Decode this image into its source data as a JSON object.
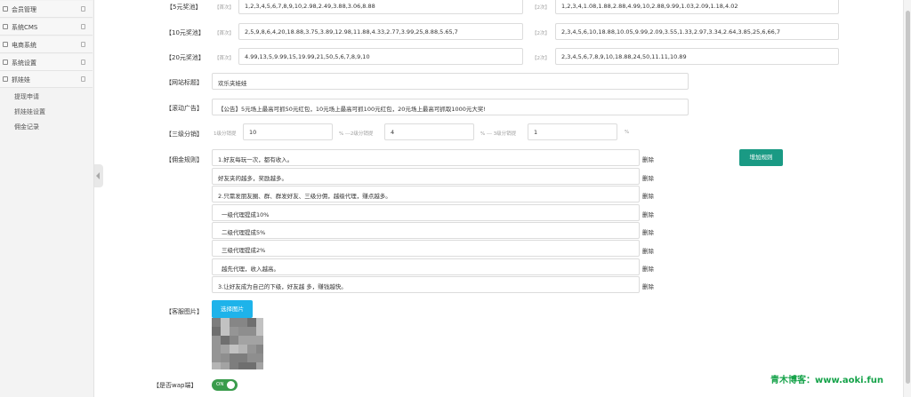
{
  "sidebar": {
    "menus": [
      {
        "label": "会员管理"
      },
      {
        "label": "系统CMS"
      },
      {
        "label": "电商系统"
      },
      {
        "label": "系统设置"
      },
      {
        "label": "抓娃娃"
      }
    ],
    "submenus": [
      {
        "label": "提现申请"
      },
      {
        "label": "抓娃娃设置"
      },
      {
        "label": "佣金记录"
      }
    ]
  },
  "form": {
    "prize5": {
      "label": "【5元奖池】",
      "tip1": "【首次】",
      "value1": "1,2,3,4,5,6,7,8,9,10,2.98,2.49,3.88,3.06,8.88",
      "tip2": "【2次】",
      "value2": "1,2,3,4,1.08,1.88,2.88,4.99,10,2.88,9.99,1.03,2.09,1.18,4.02"
    },
    "prize10": {
      "label": "【10元奖池】",
      "tip1": "【首次】",
      "value1": "2,5,9,8,6,4,20,18.88,3.75,3.89,12.98,11.88,4.33,2.77,3.99,25,8.88,5.65,7",
      "tip2": "【2次】",
      "value2": "2,3,4,5,6,10,18.88,10.05,9.99,2.09,3.55,1.33,2.97,3.34,2.64,3.85,25,6,66,7"
    },
    "prize20": {
      "label": "【20元奖池】",
      "tip1": "【首次】",
      "value1": "4.99,13,5,9.99,15,19.99,21,50,5,6,7,8,9,10",
      "tip2": "【2次】",
      "value2": "2,3,4,5,6,7,8,9,10,18.88,24,50,11.11,10.89"
    },
    "site_title": {
      "label": "【网站标题】",
      "value": "欢乐夹娃娃"
    },
    "scroll_ad": {
      "label": "【滚动广告】",
      "value": "【公告】5元场上最高可抓50元红包，10元场上最高可抓100元红包，20元场上最高可抓取1000元大奖!"
    },
    "dist": {
      "label": "【三级分销】",
      "tip1": "1级分销提",
      "v1": "10",
      "tip2": "% ---2级分销提",
      "v2": "4",
      "tip3": "% --- 3级分销提",
      "v3": "1",
      "tip4": "%"
    },
    "commission": {
      "label": "【佣金规则】",
      "add_label": "增加规则",
      "delete_label": "删除",
      "rules": [
        "1.好友每玩一次，都有收入。",
        "好友夹的越多，奖励越多。",
        "2.只需发朋友圈、群、群发好友、三级分佣，越级代理，赚点越多。",
        "一级代理提成10%",
        "二级代理提成5%",
        "三级代理提成2%",
        "越先代理，收入越高。",
        "3.让好友成为自己的下级，好友越        多，赚钱越快。"
      ]
    },
    "service_image": {
      "label": "【客服图片】",
      "button": "选择图片"
    },
    "wap": {
      "label": "【是否wap端】",
      "toggle": "ON"
    }
  },
  "watermark": "青木博客：www.aoki.fun"
}
